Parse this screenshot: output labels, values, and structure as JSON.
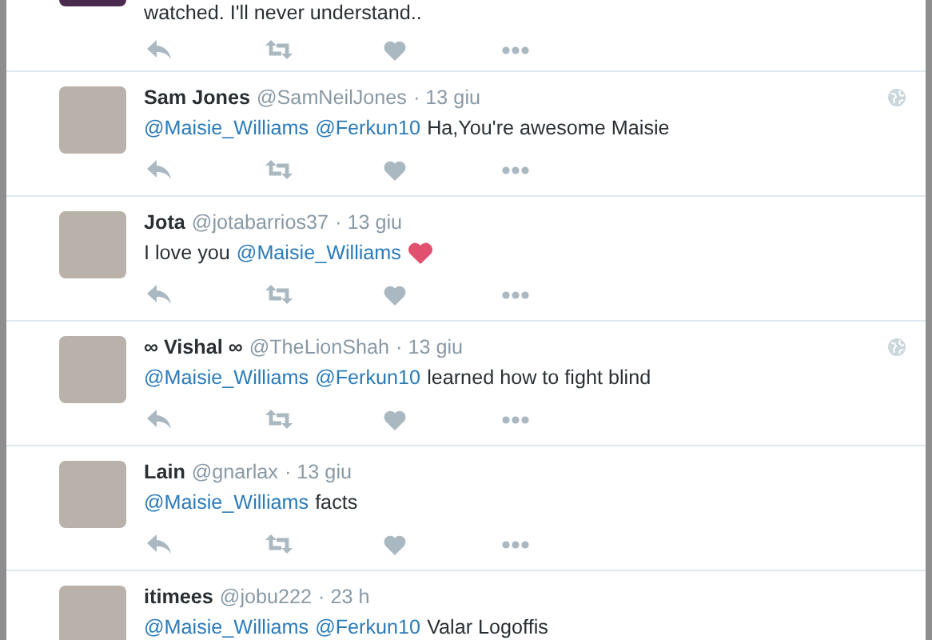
{
  "tweets": [
    {
      "globe": false,
      "text": [
        {
          "kind": "plain",
          "text": "watched. I'll never understand.."
        }
      ]
    },
    {
      "name": "Sam Jones",
      "handle": "@SamNeilJones",
      "time": "· 13 giu",
      "globe": true,
      "text": [
        {
          "kind": "mention",
          "text": "@Maisie_Williams"
        },
        {
          "kind": "mention",
          "text": "@Ferkun10"
        },
        {
          "kind": "plain",
          "text": "Ha,You're awesome Maisie"
        }
      ]
    },
    {
      "name": "Jota",
      "handle": "@jotabarrios37",
      "time": "· 13 giu",
      "globe": false,
      "text": [
        {
          "kind": "plain",
          "text": "I love you"
        },
        {
          "kind": "mention",
          "text": "@Maisie_Williams"
        },
        {
          "kind": "heart-emoji"
        }
      ]
    },
    {
      "name": "∞ Vishal ∞",
      "handle": "@TheLionShah",
      "time": "· 13 giu",
      "globe": true,
      "text": [
        {
          "kind": "mention",
          "text": "@Maisie_Williams"
        },
        {
          "kind": "mention",
          "text": "@Ferkun10"
        },
        {
          "kind": "plain",
          "text": "learned how to fight blind"
        }
      ]
    },
    {
      "name": "Lain",
      "handle": "@gnarlax",
      "time": "· 13 giu",
      "globe": false,
      "text": [
        {
          "kind": "mention",
          "text": "@Maisie_Williams"
        },
        {
          "kind": "plain",
          "text": "facts"
        }
      ]
    },
    {
      "name": "itimees",
      "handle": "@jobu222",
      "time": "· 23 h",
      "globe": false,
      "text": [
        {
          "kind": "mention",
          "text": "@Maisie_Williams"
        },
        {
          "kind": "mention",
          "text": "@Ferkun10"
        },
        {
          "kind": "plain",
          "text": "Valar Logoffis"
        }
      ]
    }
  ]
}
